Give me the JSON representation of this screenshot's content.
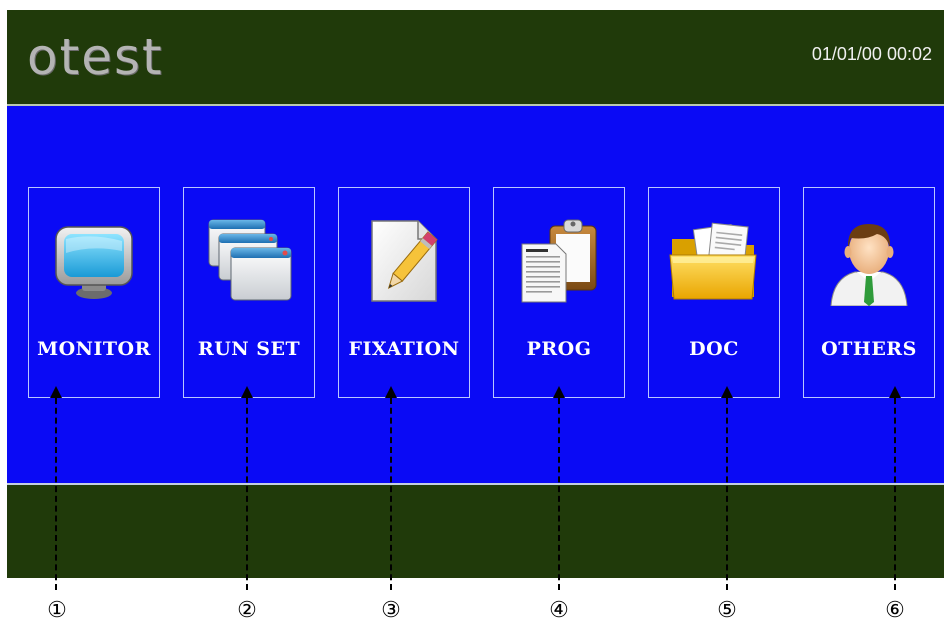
{
  "header": {
    "logo_text": "otest",
    "datetime": "01/01/00 00:02"
  },
  "tiles": [
    {
      "label": "MONITOR",
      "icon": "monitor-icon"
    },
    {
      "label": "RUN SET",
      "icon": "windows-stack-icon"
    },
    {
      "label": "FIXATION",
      "icon": "pencil-note-icon"
    },
    {
      "label": "PROG",
      "icon": "clipboard-document-icon"
    },
    {
      "label": "DOC",
      "icon": "folder-documents-icon"
    },
    {
      "label": "OTHERS",
      "icon": "user-avatar-icon"
    }
  ],
  "callouts": [
    "①",
    "②",
    "③",
    "④",
    "⑤",
    "⑥"
  ],
  "colors": {
    "frame": "#203a0a",
    "panel": "#0a0af5",
    "label": "#ffffff"
  }
}
